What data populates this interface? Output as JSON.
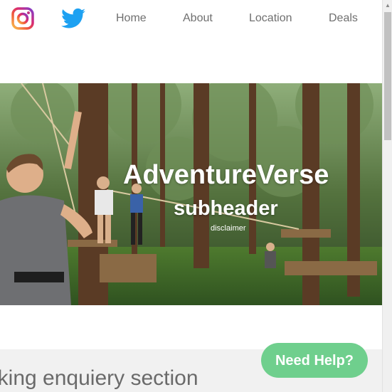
{
  "social": {
    "instagram_icon": "instagram-icon",
    "twitter_icon": "twitter-icon"
  },
  "nav": {
    "home": "Home",
    "about": "About",
    "location": "Location",
    "deals": "Deals"
  },
  "hero": {
    "title": "AdventureVerse",
    "subtitle": "subheader",
    "disclaimer": "disclaimer"
  },
  "section": {
    "title": "oking enquiery section"
  },
  "help_button": {
    "label": "Need Help?"
  },
  "colors": {
    "help_button": "#6fcf8d",
    "twitter": "#1da1f2",
    "nav_text": "#6f6f6f"
  }
}
